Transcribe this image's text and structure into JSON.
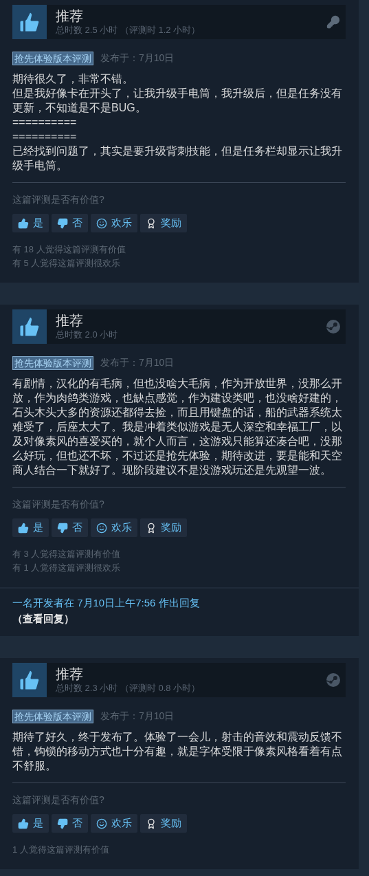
{
  "reviews": [
    {
      "verdict": "推荐",
      "hours": "总时数 2.5 小时 （评测时 1.2 小时）",
      "kind": "key",
      "tag": "抢先体验版本评测",
      "posted": "发布于：7月10日",
      "body": [
        "期待很久了，非常不错。",
        "但是我好像卡在开头了，让我升级手电筒，我升级后，但是任务没有更新，不知道是不是BUG。",
        "==========",
        "==========",
        "已经找到问题了，其实是要升级背刺技能，但是任务栏却显示让我升级手电筒。"
      ],
      "question": "这篇评测是否有价值?",
      "buttons": [
        {
          "kind": "yes",
          "label": "是"
        },
        {
          "kind": "no",
          "label": "否"
        },
        {
          "kind": "funny",
          "label": "欢乐"
        },
        {
          "kind": "award",
          "label": "奖励"
        }
      ],
      "counts": [
        "有 18 人觉得这篇评测有价值",
        "有 5 人觉得这篇评测很欢乐"
      ]
    },
    {
      "verdict": "推荐",
      "hours": "总时数 2.0 小时",
      "kind": "steam",
      "tag": "抢先体验版本评测",
      "posted": "发布于：7月10日",
      "body": [
        "有剧情，汉化的有毛病，但也没啥大毛病，作为开放世界，没那么开放，作为肉鸽类游戏，也缺点感觉，作为建设类吧，也没啥好建的，石头木头大多的资源还都得去捡，而且用键盘的话，船的武器系统太难受了，后座太大了。我是冲着类似游戏是无人深空和幸福工厂，以及对像素风的喜爱买的，就个人而言，这游戏只能算还凑合吧，没那么好玩，但也还不坏，不过还是抢先体验，期待改进，要是能和天空商人结合一下就好了。现阶段建议不是没游戏玩还是先观望一波。"
      ],
      "question": "这篇评测是否有价值?",
      "buttons": [
        {
          "kind": "yes",
          "label": "是"
        },
        {
          "kind": "no",
          "label": "否"
        },
        {
          "kind": "funny",
          "label": "欢乐"
        },
        {
          "kind": "award",
          "label": "奖励"
        }
      ],
      "counts": [
        "有 3 人觉得这篇评测有价值",
        "有 1 人觉得这篇评测很欢乐"
      ],
      "developer_reply": {
        "text": "一名开发者在 7月10日上午7:56 作出回复",
        "link": "（查看回复）"
      }
    },
    {
      "verdict": "推荐",
      "hours": "总时数 2.3 小时 （评测时 0.8 小时）",
      "kind": "steam",
      "tag": "抢先体验版本评测",
      "posted": "发布于：7月10日",
      "body": [
        "期待了好久，终于发布了。体验了一会儿，射击的音效和震动反馈不错，钩锁的移动方式也十分有趣，就是字体受限于像素风格看着有点不舒服。"
      ],
      "question": "这篇评测是否有价值?",
      "buttons": [
        {
          "kind": "yes",
          "label": "是"
        },
        {
          "kind": "no",
          "label": "否"
        },
        {
          "kind": "funny",
          "label": "欢乐"
        },
        {
          "kind": "award",
          "label": "奖励"
        }
      ],
      "counts": [
        "1 人觉得这篇评测有价值"
      ]
    }
  ]
}
